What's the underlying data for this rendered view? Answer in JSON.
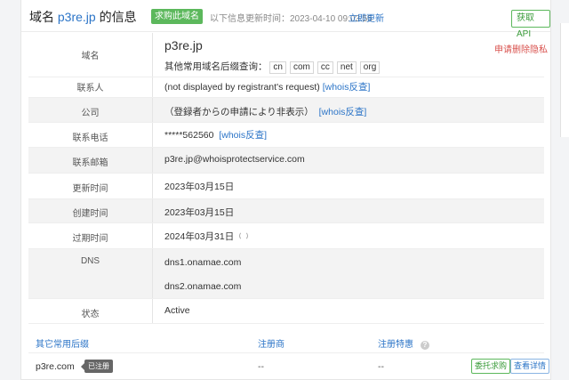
{
  "header": {
    "title_prefix": "域名 ",
    "domain": "p3re.jp",
    "title_suffix": " 的信息",
    "buy_label": "求购此域名",
    "update_text": "以下信息更新时间：2023-04-10 09:03:55",
    "refresh_label": "立即更新",
    "api_label": "获取API"
  },
  "info": {
    "domain_label": "域名",
    "domain_value": "p3re.jp",
    "report_label": "申请删除隐私",
    "suffix_prompt": "其他常用域名后缀查询：",
    "suffixes": [
      "cn",
      "com",
      "cc",
      "net",
      "org"
    ],
    "contact_label": "联系人",
    "contact_value": "(not displayed by registrant's request)",
    "whois_label": "[whois反查]",
    "company_label": "公司",
    "company_value": "（登録者からの申請により非表示）",
    "phone_label": "联系电话",
    "phone_value": "*****562560",
    "email_label": "联系邮箱",
    "email_value": "p3re.jp@whoisprotectservice.com",
    "updated_label": "更新时间",
    "updated_value": "2023年03月15日",
    "created_label": "创建时间",
    "created_value": "2023年03月15日",
    "expires_label": "过期时间",
    "expires_value": "2024年03月31日",
    "dns_label": "DNS",
    "dns": [
      "dns1.onamae.com",
      "dns2.onamae.com"
    ],
    "status_label": "状态",
    "status_value": "Active"
  },
  "other": {
    "col_suffix": "其它常用后缀",
    "col_registrar": "注册商",
    "col_special": "注册特惠",
    "rows": [
      {
        "name": "p3re.com",
        "badge": "已注册",
        "registrar": "--",
        "special": "--",
        "btn_buy": "委托求购",
        "btn_detail": "查看详情"
      }
    ]
  },
  "colors": {
    "accent": "#2b74c7",
    "green": "#5cb85c",
    "red": "#d9534f"
  }
}
